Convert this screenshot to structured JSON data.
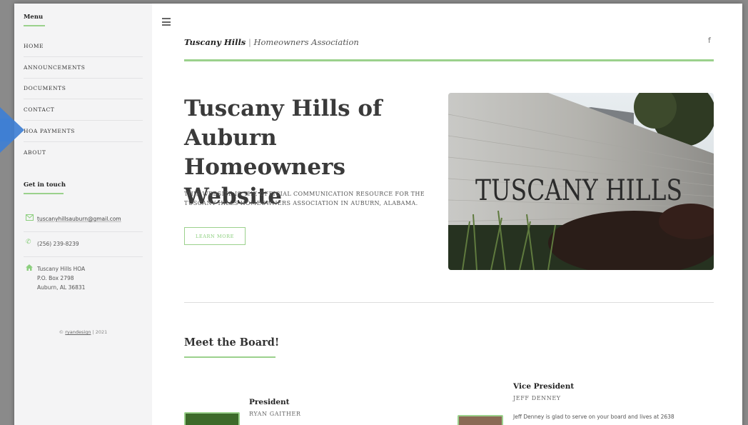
{
  "sidebar": {
    "menu_heading": "Menu",
    "menu_items": [
      {
        "label": "HOME"
      },
      {
        "label": "ANNOUNCEMENTS"
      },
      {
        "label": "DOCUMENTS"
      },
      {
        "label": "CONTACT"
      },
      {
        "label": "HOA PAYMENTS"
      },
      {
        "label": "ABOUT"
      }
    ],
    "contact_heading": "Get in touch",
    "email": "tuscanyhillsauburn@gmail.com",
    "phone": "(256) 239-8239",
    "address": {
      "line1": "Tuscany Hills HOA",
      "line2": "P.O. Box 2798",
      "line3": "Auburn, AL 36831"
    },
    "copyright": {
      "prefix": "©",
      "link": "ryandesign",
      "suffix": "| 2021"
    }
  },
  "header": {
    "brand_name": "Tuscany Hills",
    "separator": "|",
    "brand_sub": "Homeowners Association",
    "social_icon": "facebook-icon",
    "social_glyph": "f"
  },
  "hero": {
    "title": "Tuscany Hills of Auburn Homeowners Website",
    "description": "THIS WEBSITE IS THE OFFICIAL COMMUNICATION RESOURCE FOR THE TUSCANY HILLS HOMEOWNERS ASSOCIATION IN AUBURN, ALABAMA.",
    "button_label": "LEARN MORE",
    "image_sign_text": "TUSCANY HILLS"
  },
  "board": {
    "heading": "Meet the Board!",
    "members": [
      {
        "role": "President",
        "name": "RYAN GAITHER",
        "bio": ""
      },
      {
        "role": "Vice President",
        "name": "JEFF DENNEY",
        "bio": "Jeff Denney is glad to serve on your board and lives at 2638"
      }
    ]
  },
  "colors": {
    "accent": "#9bd18c",
    "arrow": "#3f7fd4",
    "sidebar_bg": "#f4f4f5"
  }
}
